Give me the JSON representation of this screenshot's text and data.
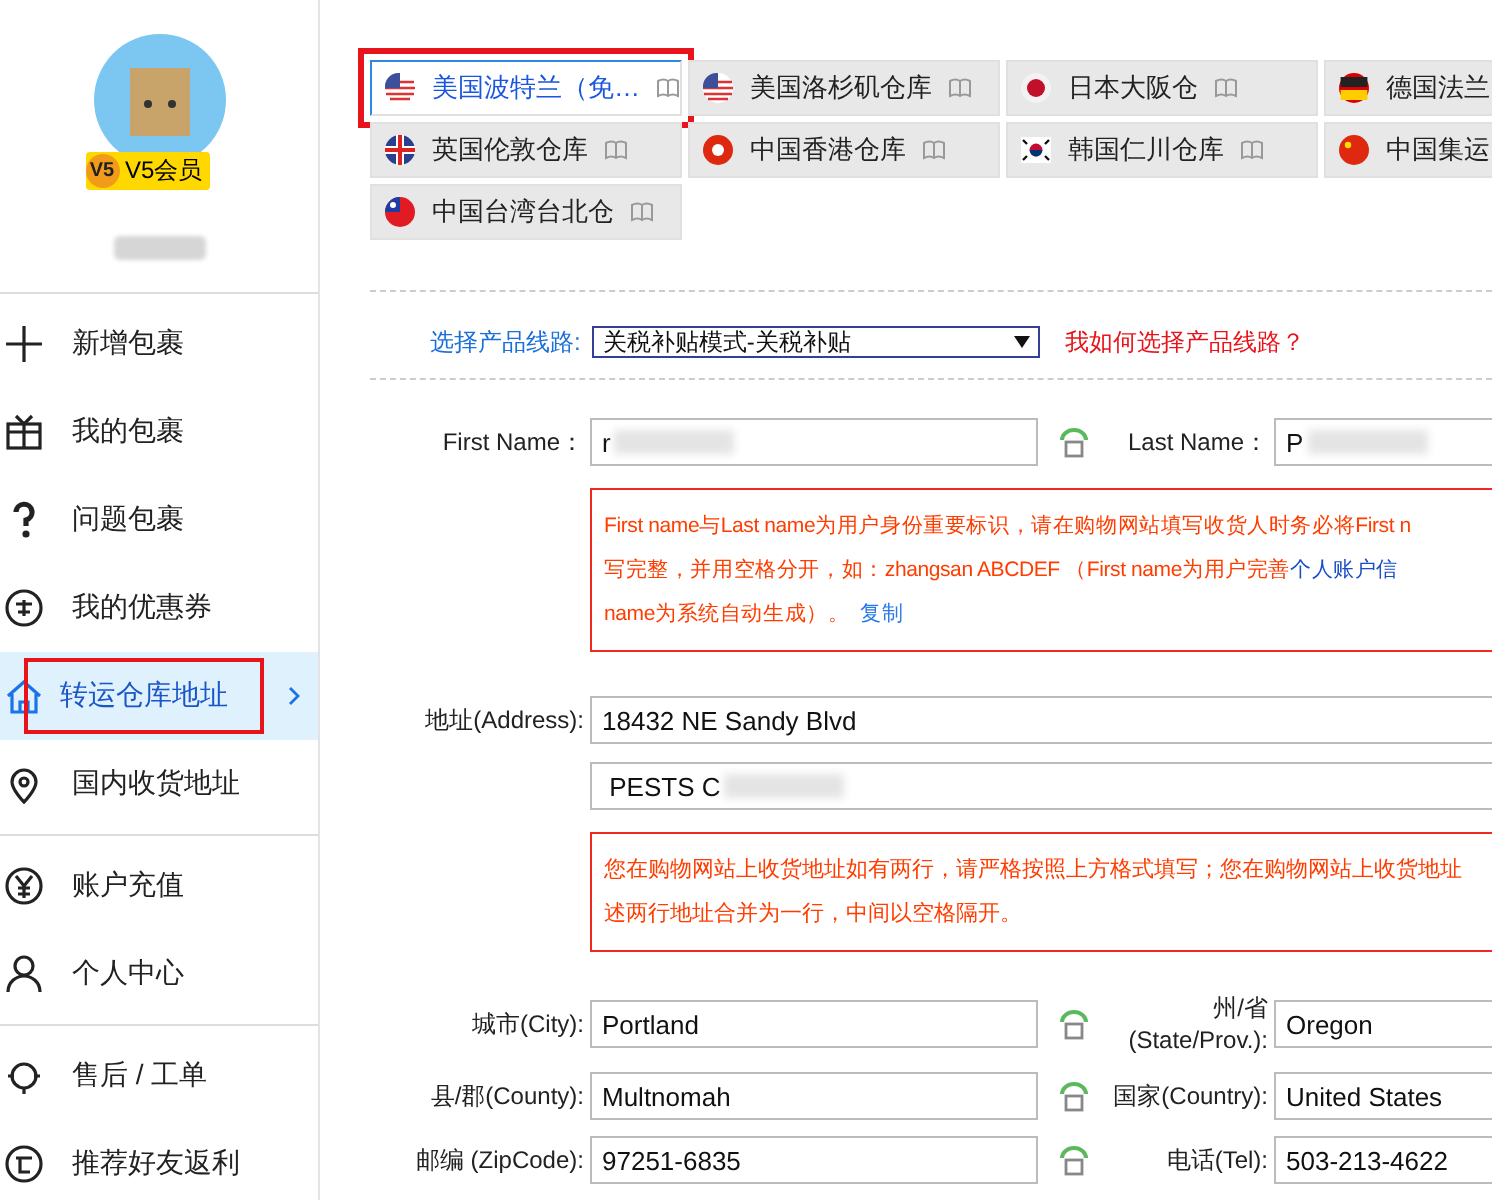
{
  "sidebar": {
    "badge": {
      "level": "V5",
      "label": "V5会员"
    },
    "groups": [
      [
        {
          "label": "新增包裹",
          "selected": false,
          "highlighted": false
        },
        {
          "label": "我的包裹",
          "selected": false,
          "highlighted": false
        },
        {
          "label": "问题包裹",
          "selected": false,
          "highlighted": false
        },
        {
          "label": "我的优惠券",
          "selected": false,
          "highlighted": false
        },
        {
          "label": "转运仓库地址",
          "selected": true,
          "highlighted": true
        },
        {
          "label": "国内收货地址",
          "selected": false,
          "highlighted": false
        }
      ],
      [
        {
          "label": "账户充值",
          "selected": false,
          "highlighted": false
        },
        {
          "label": "个人中心",
          "selected": false,
          "highlighted": false
        }
      ],
      [
        {
          "label": "售后 / 工单",
          "selected": false,
          "highlighted": false
        },
        {
          "label": "推荐好友返利",
          "selected": false,
          "highlighted": false
        }
      ]
    ]
  },
  "tabs": [
    {
      "label": "美国波特兰（免…",
      "selected": true,
      "highlighted": true
    },
    {
      "label": "美国洛杉矶仓库",
      "selected": false,
      "highlighted": false
    },
    {
      "label": "日本大阪仓",
      "selected": false,
      "highlighted": false
    },
    {
      "label": "德国法兰",
      "selected": false,
      "highlighted": false
    },
    {
      "label": "英国伦敦仓库",
      "selected": false,
      "highlighted": false
    },
    {
      "label": "中国香港仓库",
      "selected": false,
      "highlighted": false
    },
    {
      "label": "韩国仁川仓库",
      "selected": false,
      "highlighted": false
    },
    {
      "label": "中国集运",
      "selected": false,
      "highlighted": false
    },
    {
      "label": "中国台湾台北仓",
      "selected": false,
      "highlighted": false
    }
  ],
  "product_line": {
    "label": "选择产品线路:",
    "value": "关税补贴模式-关税补贴",
    "help_link": "我如何选择产品线路？"
  },
  "name_row": {
    "first": {
      "label": "First Name：",
      "value": "r"
    },
    "last": {
      "label": "Last Name：",
      "value": "P"
    }
  },
  "name_note": {
    "lines": [
      "First name与Last name为用户身份重要标识，请在购物网站填写收货人时务必将First n",
      "写完整，并用空格分开，如：zhangsan ABCDEF （First name为用户完善"
    ],
    "link": "个人账户信",
    "last_line": "name为系统自动生成）。",
    "copy_link": "复制"
  },
  "address": {
    "label": "地址(Address):",
    "lines": [
      "18432 NE Sandy Blvd",
      "PESTS C"
    ]
  },
  "address_note": {
    "lines": [
      "您在购物网站上收货地址如有两行，请严格按照上方格式填写；您在购物网站上收货地址",
      "述两行地址合并为一行，中间以空格隔开。"
    ]
  },
  "rows": [
    {
      "left": {
        "label": "城市(City):",
        "value": "Portland"
      },
      "right": {
        "label": "州/省 (State/Prov.):",
        "value": "Oregon"
      }
    },
    {
      "left": {
        "label": "县/郡(County):",
        "value": "Multnomah"
      },
      "right": {
        "label": "国家(Country):",
        "value": "United States"
      }
    },
    {
      "left": {
        "label": "邮编 (ZipCode):",
        "value": "97251-6835"
      },
      "right": {
        "label": "电话(Tel):",
        "value": "503-213-4622"
      }
    }
  ]
}
